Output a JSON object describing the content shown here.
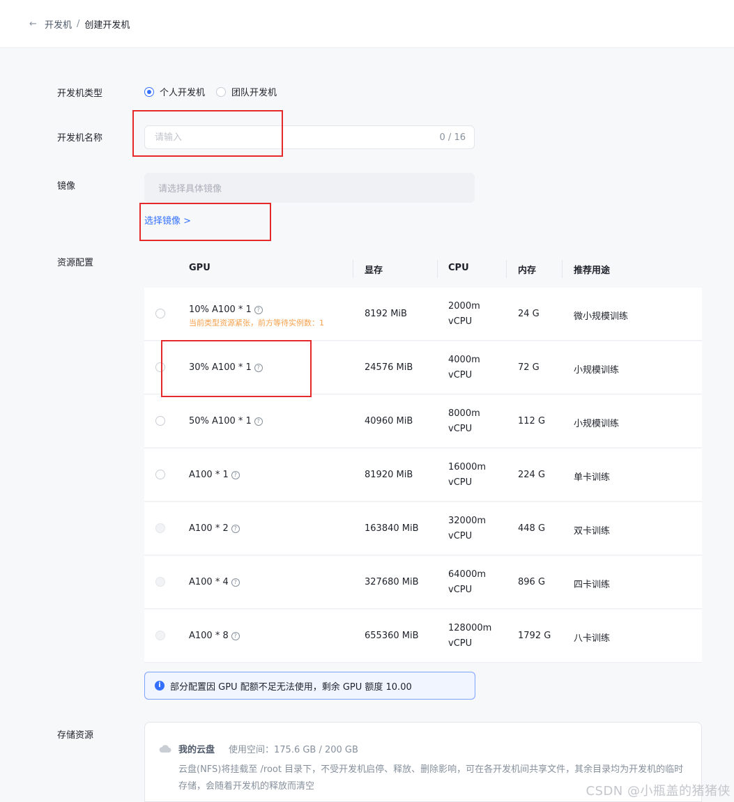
{
  "breadcrumb": {
    "back_icon": "arrow-left-icon",
    "parent": "开发机",
    "separator": "/",
    "current": "创建开发机"
  },
  "form": {
    "type_label": "开发机类型",
    "type_options": [
      {
        "label": "个人开发机",
        "checked": true
      },
      {
        "label": "团队开发机",
        "checked": false
      }
    ],
    "name_label": "开发机名称",
    "name_placeholder": "请输入",
    "name_counter": "0 / 16",
    "image_label": "镜像",
    "image_placeholder": "请选择具体镜像",
    "image_link": "选择镜像 >",
    "resource_label": "资源配置",
    "storage_label": "存储资源"
  },
  "resource_table": {
    "headers": [
      "GPU",
      "显存",
      "CPU",
      "内存",
      "推荐用途"
    ],
    "rows": [
      {
        "gpu": "10% A100 * 1",
        "vram": "8192 MiB",
        "cpu_amount": "2000m",
        "cpu_unit": "vCPU",
        "mem": "24 G",
        "usage": "微小规模训练",
        "warning": "当前类型资源紧张，前方等待实例数：1",
        "disabled": false
      },
      {
        "gpu": "30% A100 * 1",
        "vram": "24576 MiB",
        "cpu_amount": "4000m",
        "cpu_unit": "vCPU",
        "mem": "72 G",
        "usage": "小规模训练",
        "disabled": false
      },
      {
        "gpu": "50% A100 * 1",
        "vram": "40960 MiB",
        "cpu_amount": "8000m",
        "cpu_unit": "vCPU",
        "mem": "112 G",
        "usage": "小规模训练",
        "disabled": false
      },
      {
        "gpu": "A100 * 1",
        "vram": "81920 MiB",
        "cpu_amount": "16000m",
        "cpu_unit": "vCPU",
        "mem": "224 G",
        "usage": "单卡训练",
        "disabled": false
      },
      {
        "gpu": "A100 * 2",
        "vram": "163840 MiB",
        "cpu_amount": "32000m",
        "cpu_unit": "vCPU",
        "mem": "448 G",
        "usage": "双卡训练",
        "disabled": true
      },
      {
        "gpu": "A100 * 4",
        "vram": "327680 MiB",
        "cpu_amount": "64000m",
        "cpu_unit": "vCPU",
        "mem": "896 G",
        "usage": "四卡训练",
        "disabled": true
      },
      {
        "gpu": "A100 * 8",
        "vram": "655360 MiB",
        "cpu_amount": "128000m",
        "cpu_unit": "vCPU",
        "mem": "1792 G",
        "usage": "八卡训练",
        "disabled": true
      }
    ]
  },
  "tip": {
    "icon": "info-icon",
    "text": "部分配置因 GPU 配额不足无法使用，剩余 GPU 额度 10.00"
  },
  "storage": {
    "icon": "cloud-icon",
    "title": "我的云盘",
    "used": "使用空间：175.6 GB / 200 GB",
    "description": "云盘(NFS)将挂载至 /root 目录下，不受开发机启停、释放、删除影响，可在各开发机间共享文件，其余目录均为开发机的临时存储，会随着开发机的释放而清空"
  },
  "watermark": "CSDN @小瓶盖的猪猪侠",
  "colors": {
    "primary": "#3370ff",
    "warning": "#f7a04b",
    "annotation": "#e5282a"
  }
}
